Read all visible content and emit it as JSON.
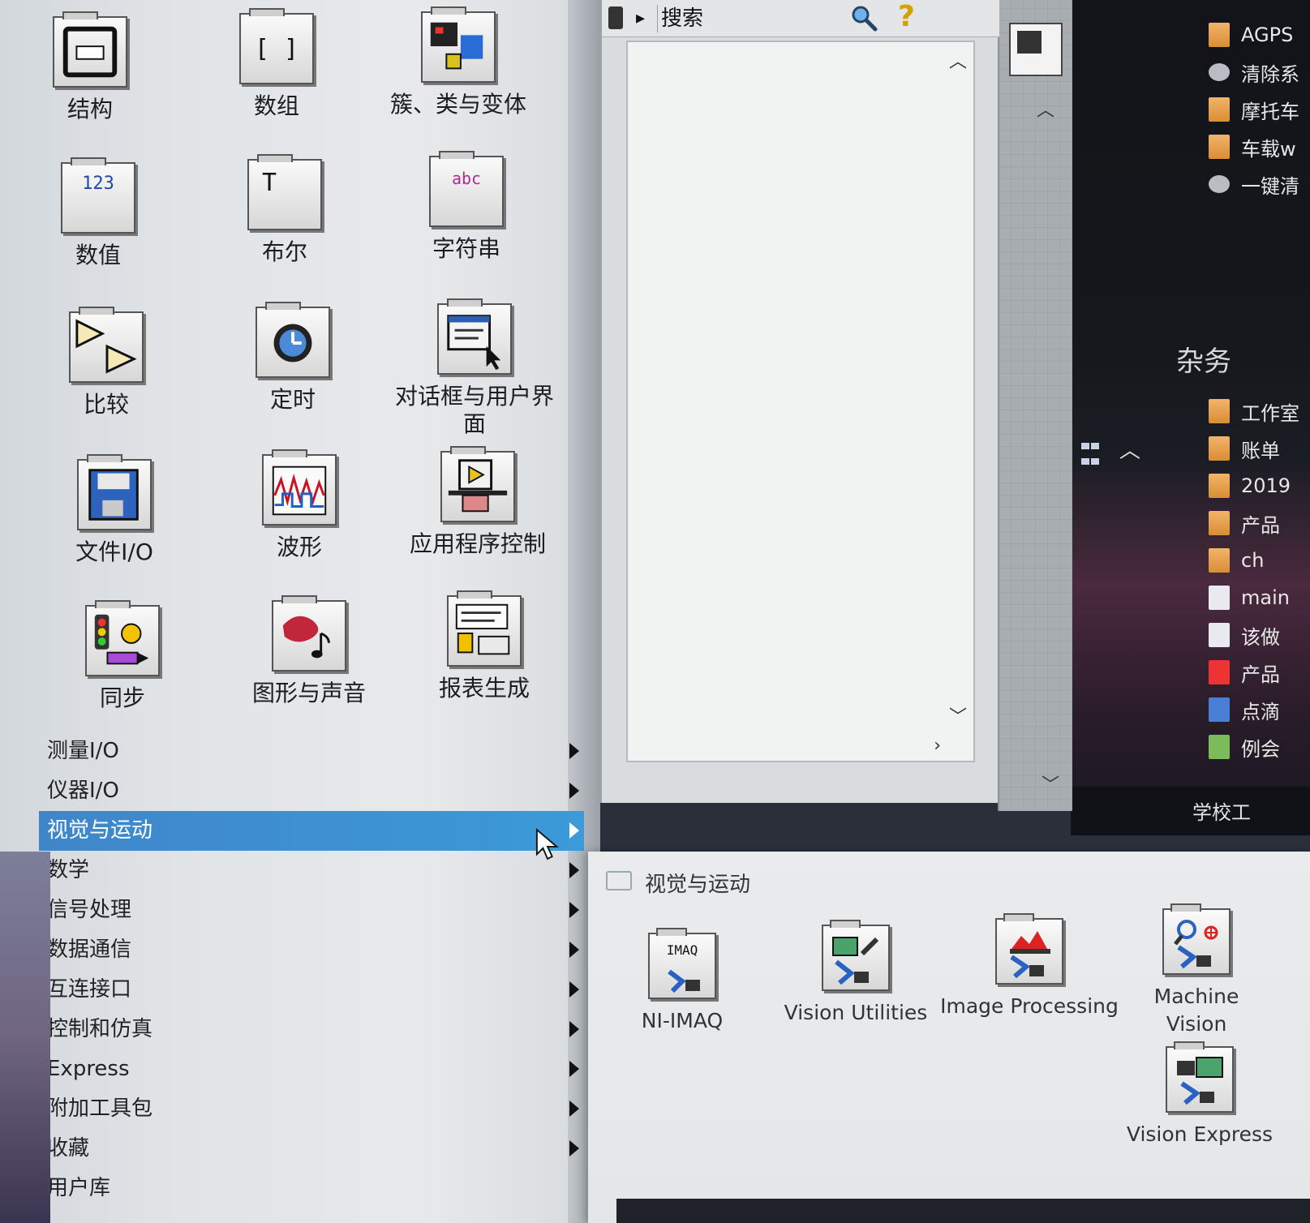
{
  "palette": {
    "icons": [
      {
        "label": "结构",
        "icon": "structure-icon"
      },
      {
        "label": "数组",
        "icon": "array-icon"
      },
      {
        "label": "簇、类与变体",
        "icon": "cluster-class-variant-icon"
      },
      {
        "label": "数值",
        "icon": "numeric-icon"
      },
      {
        "label": "布尔",
        "icon": "boolean-icon"
      },
      {
        "label": "字符串",
        "icon": "string-icon"
      },
      {
        "label": "比较",
        "icon": "comparison-icon"
      },
      {
        "label": "定时",
        "icon": "timing-icon"
      },
      {
        "label": "对话框与用户界面",
        "icon": "dialog-ui-icon"
      },
      {
        "label": "文件I/O",
        "icon": "file-io-icon"
      },
      {
        "label": "波形",
        "icon": "waveform-icon"
      },
      {
        "label": "应用程序控制",
        "icon": "application-control-icon"
      },
      {
        "label": "同步",
        "icon": "synchronization-icon"
      },
      {
        "label": "图形与声音",
        "icon": "graphics-sound-icon"
      },
      {
        "label": "报表生成",
        "icon": "report-generation-icon"
      }
    ],
    "icon_glyphs": {
      "array": "[ ]",
      "numeric": "123",
      "boolean": "T",
      "string": "abc"
    },
    "categories": [
      {
        "label": "测量I/O",
        "has_submenu": true
      },
      {
        "label": "仪器I/O",
        "has_submenu": true
      },
      {
        "label": "视觉与运动",
        "has_submenu": true,
        "selected": true
      },
      {
        "label": "数学",
        "has_submenu": true
      },
      {
        "label": "信号处理",
        "has_submenu": true
      },
      {
        "label": "数据通信",
        "has_submenu": true
      },
      {
        "label": "互连接口",
        "has_submenu": true
      },
      {
        "label": "控制和仿真",
        "has_submenu": true
      },
      {
        "label": "Express",
        "has_submenu": true
      },
      {
        "label": "附加工具包",
        "has_submenu": true
      },
      {
        "label": "收藏",
        "has_submenu": true
      },
      {
        "label": "用户库",
        "has_submenu": false
      }
    ]
  },
  "search": {
    "label": "搜索",
    "help_glyph": "?"
  },
  "submenu": {
    "title": "视觉与运动",
    "items": [
      {
        "label": "NI-IMAQ",
        "icon": "ni-imaq-icon",
        "glyph": "IMAQ"
      },
      {
        "label": "Vision Utilities",
        "icon": "vision-utilities-icon"
      },
      {
        "label": "Image Processing",
        "icon": "image-processing-icon"
      },
      {
        "label": "Machine Vision",
        "icon": "machine-vision-icon"
      },
      {
        "label": "Vision Express",
        "icon": "vision-express-icon"
      }
    ]
  },
  "desktop": {
    "items_top": [
      "AGPS",
      "清除系",
      "摩托车",
      "车载w",
      "一键清"
    ],
    "section_header": "杂务",
    "items_bottom": [
      "工作室",
      "账单",
      "2019",
      "产品",
      "ch",
      "main",
      "该做",
      "产品",
      "点滴",
      "例会"
    ],
    "taskbar_text": "学校工"
  },
  "colors": {
    "selection": "#3c8fd0",
    "palette_bg": "#e3e6e8",
    "desktop_bg": "#15171c"
  }
}
